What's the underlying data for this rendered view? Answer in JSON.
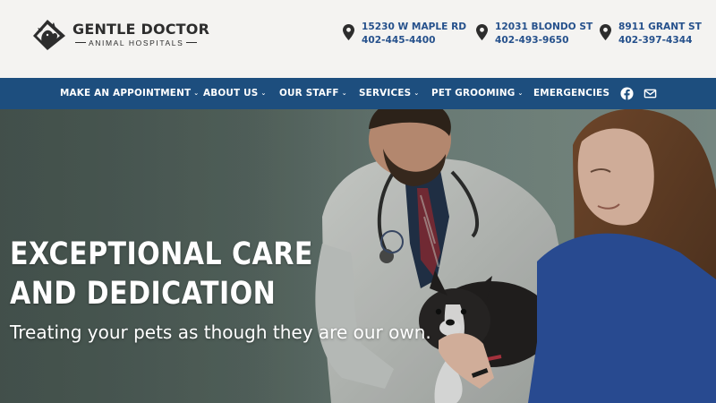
{
  "brand": {
    "name": "GENTLE DOCTOR",
    "tagline": "ANIMAL HOSPITALS"
  },
  "locations": [
    {
      "address": "15230 W MAPLE RD",
      "phone": "402-445-4400"
    },
    {
      "address": "12031 BLONDO ST",
      "phone": "402-493-9650"
    },
    {
      "address": "8911 GRANT ST",
      "phone": "402-397-4344"
    }
  ],
  "nav": {
    "items": [
      {
        "label": "MAKE AN APPOINTMENT",
        "dropdown": "⌄"
      },
      {
        "label": "ABOUT US",
        "dropdown": "⌄"
      },
      {
        "label": "OUR STAFF",
        "dropdown": "⌄"
      },
      {
        "label": "SERVICES",
        "dropdown": "⌄"
      },
      {
        "label": "PET GROOMING",
        "dropdown": "⌄"
      },
      {
        "label": "EMERGENCIES"
      }
    ],
    "icons": [
      "facebook-icon",
      "email-icon"
    ]
  },
  "hero": {
    "title_line1": "EXCEPTIONAL CARE",
    "title_line2": "AND DEDICATION",
    "subtitle": "Treating your pets as though they are our own."
  },
  "colors": {
    "nav_bg": "#1d4e7e",
    "link_blue": "#26518c",
    "header_bg": "#f4f3f1",
    "logo_dark": "#2d2d2d"
  }
}
